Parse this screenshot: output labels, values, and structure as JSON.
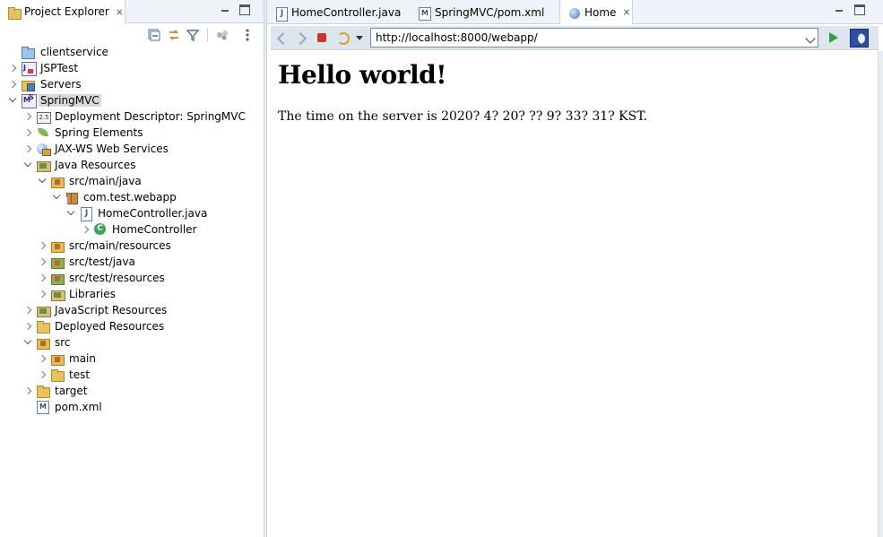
{
  "explorer": {
    "tab_label": "Project Explorer",
    "tab_close": "⨯"
  },
  "tree": [
    {
      "label": "clientservice"
    },
    {
      "label": "JSPTest"
    },
    {
      "label": "Servers"
    },
    {
      "label": "SpringMVC"
    },
    {
      "label": "Deployment Descriptor: SpringMVC"
    },
    {
      "label": "Spring Elements"
    },
    {
      "label": "JAX-WS Web Services"
    },
    {
      "label": "Java Resources"
    },
    {
      "label": "src/main/java"
    },
    {
      "label": "com.test.webapp"
    },
    {
      "label": "HomeController.java"
    },
    {
      "label": "HomeController"
    },
    {
      "label": "src/main/resources"
    },
    {
      "label": "src/test/java"
    },
    {
      "label": "src/test/resources"
    },
    {
      "label": "Libraries"
    },
    {
      "label": "JavaScript Resources"
    },
    {
      "label": "Deployed Resources"
    },
    {
      "label": "src"
    },
    {
      "label": "main"
    },
    {
      "label": "test"
    },
    {
      "label": "target"
    },
    {
      "label": "pom.xml"
    }
  ],
  "editor": {
    "tabs": [
      {
        "label": "HomeController.java"
      },
      {
        "label": "SpringMVC/pom.xml"
      },
      {
        "label": "Home",
        "close": "⨯"
      }
    ]
  },
  "browser": {
    "url": "http://localhost:8000/webapp/"
  },
  "page": {
    "heading": "Hello world!",
    "text": "The time on the server is 2020? 4? 20? ?? 9? 33? 31? KST."
  },
  "colors": {
    "tab_bar": "#eef3f9",
    "border": "#c9d3df",
    "selection": "#d9d9d9",
    "stop": "#d03030",
    "go": "#3a9a4a"
  }
}
